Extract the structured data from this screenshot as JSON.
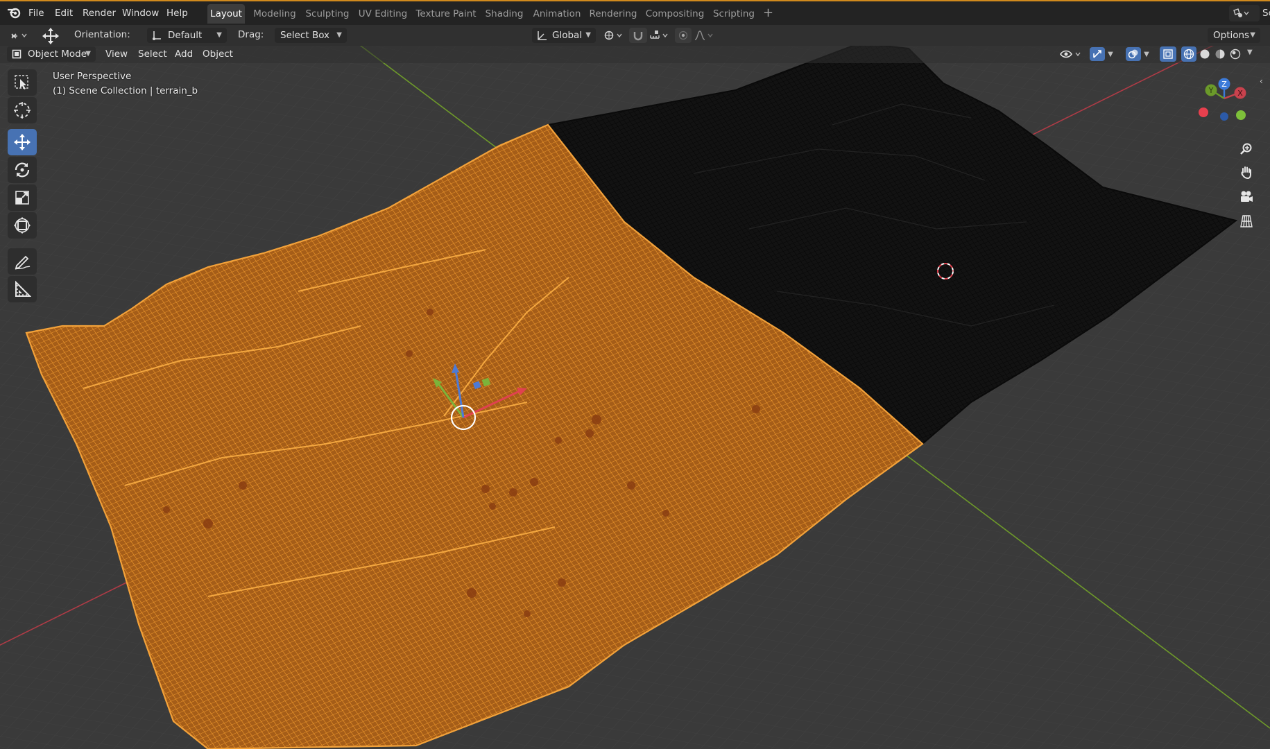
{
  "menu": {
    "file": "File",
    "edit": "Edit",
    "render": "Render",
    "window": "Window",
    "help": "Help"
  },
  "workspaces": [
    {
      "label": "Layout",
      "active": true
    },
    {
      "label": "Modeling",
      "active": false
    },
    {
      "label": "Sculpting",
      "active": false
    },
    {
      "label": "UV Editing",
      "active": false
    },
    {
      "label": "Texture Paint",
      "active": false
    },
    {
      "label": "Shading",
      "active": false
    },
    {
      "label": "Animation",
      "active": false
    },
    {
      "label": "Rendering",
      "active": false
    },
    {
      "label": "Compositing",
      "active": false
    },
    {
      "label": "Scripting",
      "active": false
    }
  ],
  "scene_truncated": "Sc",
  "tool_header": {
    "orientation_label": "Orientation:",
    "orientation_value": "Default",
    "drag_label": "Drag:",
    "drag_value": "Select Box",
    "transform_orientation": "Global",
    "options_label": "Options"
  },
  "view_header": {
    "mode": "Object Mode",
    "view": "View",
    "select": "Select",
    "add": "Add",
    "object": "Object"
  },
  "viewport": {
    "perspective": "User Perspective",
    "collection_info": "(1) Scene Collection | terrain_b"
  },
  "gizmo": {
    "x_label": "X",
    "y_label": "Y",
    "z_label": "Z"
  },
  "colors": {
    "selected_wire": "#e8922c",
    "unselected_wire": "#0e0e0e",
    "x_axis": "#c8424d",
    "y_axis": "#6e9a2a",
    "active_tool": "#4772b3",
    "accent": "#d18a1d"
  }
}
